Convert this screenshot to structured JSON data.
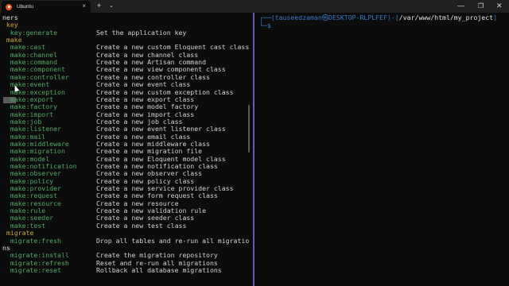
{
  "window": {
    "tab_title": "Ubuntu",
    "tab_close": "×",
    "new_tab": "+",
    "dropdown": "⌄",
    "minimize": "—",
    "maximize": "❐",
    "close": "✕"
  },
  "left_pane": {
    "lines": [
      {
        "type": "ns",
        "cmd": "ners",
        "desc": ""
      },
      {
        "type": "ns",
        "cmd": " key",
        "desc": ""
      },
      {
        "type": "cmd",
        "cmd": "  key:generate",
        "desc": "Set the application key"
      },
      {
        "type": "ns",
        "cmd": " make",
        "desc": ""
      },
      {
        "type": "cmd",
        "cmd": "  make:cast",
        "desc": "Create a new custom Eloquent cast class"
      },
      {
        "type": "cmd",
        "cmd": "  make:channel",
        "desc": "Create a new channel class"
      },
      {
        "type": "cmd",
        "cmd": "  make:command",
        "desc": "Create a new Artisan command"
      },
      {
        "type": "cmd",
        "cmd": "  make:component",
        "desc": "Create a new view component class"
      },
      {
        "type": "cmd",
        "cmd": "  make:controller",
        "desc": "Create a new controller class"
      },
      {
        "type": "cmd",
        "cmd": "  make:event",
        "desc": "Create a new event class"
      },
      {
        "type": "cmd",
        "cmd": "  make:exception",
        "desc": "Create a new custom exception class"
      },
      {
        "type": "cmd",
        "cmd": "  make:export",
        "desc": "Create a new export class"
      },
      {
        "type": "cmd",
        "cmd": "  make:factory",
        "desc": "Create a new model factory"
      },
      {
        "type": "cmd",
        "cmd": "  make:import",
        "desc": "Create a new import class"
      },
      {
        "type": "cmd",
        "cmd": "  make:job",
        "desc": "Create a new job class"
      },
      {
        "type": "cmd",
        "cmd": "  make:listener",
        "desc": "Create a new event listener class"
      },
      {
        "type": "cmd",
        "cmd": "  make:mail",
        "desc": "Create a new email class"
      },
      {
        "type": "cmd",
        "cmd": "  make:middleware",
        "desc": "Create a new middleware class"
      },
      {
        "type": "cmd",
        "cmd": "  make:migration",
        "desc": "Create a new migration file"
      },
      {
        "type": "cmd",
        "cmd": "  make:model",
        "desc": "Create a new Eloquent model class"
      },
      {
        "type": "cmd",
        "cmd": "  make:notification",
        "desc": "Create a new notification class"
      },
      {
        "type": "cmd",
        "cmd": "  make:observer",
        "desc": "Create a new observer class"
      },
      {
        "type": "cmd",
        "cmd": "  make:policy",
        "desc": "Create a new policy class"
      },
      {
        "type": "cmd",
        "cmd": "  make:provider",
        "desc": "Create a new service provider class"
      },
      {
        "type": "cmd",
        "cmd": "  make:request",
        "desc": "Create a new form request class"
      },
      {
        "type": "cmd",
        "cmd": "  make:resource",
        "desc": "Create a new resource"
      },
      {
        "type": "cmd",
        "cmd": "  make:rule",
        "desc": "Create a new validation rule"
      },
      {
        "type": "cmd",
        "cmd": "  make:seeder",
        "desc": "Create a new seeder class"
      },
      {
        "type": "cmd",
        "cmd": "  make:test",
        "desc": "Create a new test class"
      },
      {
        "type": "ns",
        "cmd": " migrate",
        "desc": ""
      },
      {
        "type": "cmd",
        "cmd": "  migrate:fresh",
        "desc": "Drop all tables and re-run all migratio"
      },
      {
        "type": "ns-white",
        "cmd": "ns",
        "desc": ""
      },
      {
        "type": "cmd",
        "cmd": "  migrate:install",
        "desc": "Create the migration repository"
      },
      {
        "type": "cmd",
        "cmd": "  migrate:refresh",
        "desc": "Reset and re-run all migrations"
      },
      {
        "type": "cmd",
        "cmd": "  migrate:reset",
        "desc": "Rollback all database migrations"
      }
    ]
  },
  "right_pane": {
    "prompt_prefix": "┌──(",
    "user_host": "tauseedzaman㉿DESKTOP-RLPLFEF",
    "prompt_sep": ")-[",
    "path": "/var/www/html/my_project",
    "prompt_suffix": "]",
    "prompt_line2": "└─$"
  },
  "colors": {
    "background": "#0c0c0c",
    "command_green": "#54a866",
    "namespace_yellow": "#c8a84b",
    "prompt_blue": "#3b78c9",
    "divider_purple": "#6e59a8"
  }
}
